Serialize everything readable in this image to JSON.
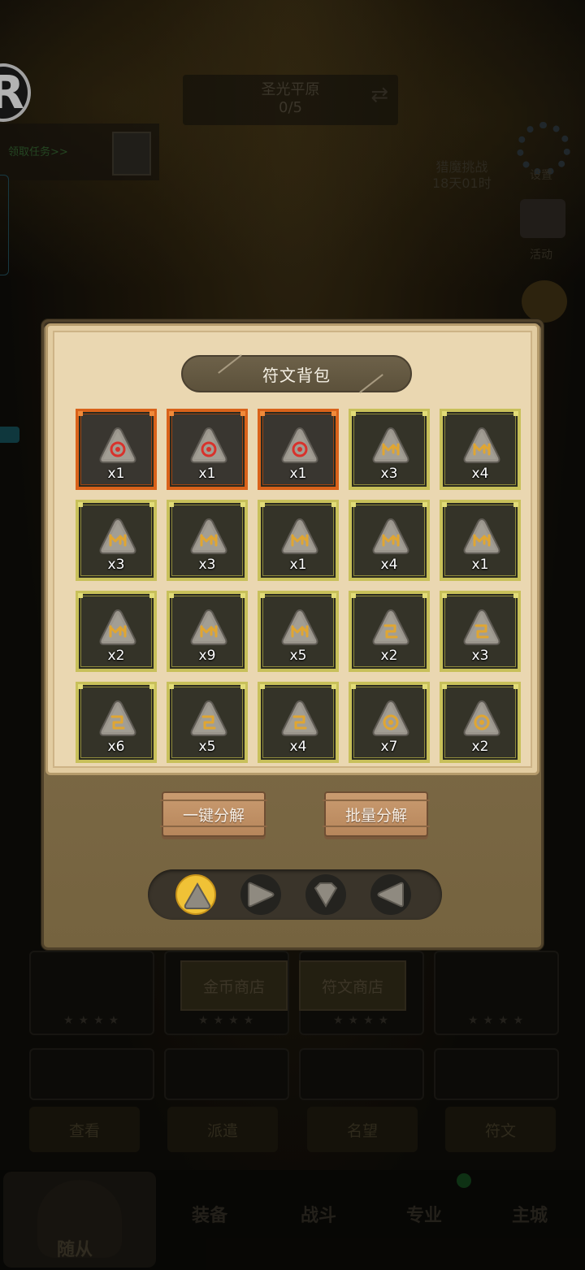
{
  "background": {
    "area_name": "圣光平原",
    "area_progress": "0/5",
    "task_link": "领取任务>>",
    "hunt_line1": "猎魔挑战",
    "hunt_line2": "18天01时",
    "settings_label": "设置",
    "notice_label": "活动",
    "gold_shop": "金币商店",
    "rune_shop": "符文商店",
    "tabs": [
      "查看",
      "派遣",
      "名望",
      "符文"
    ],
    "nav": [
      "随从",
      "装备",
      "战斗",
      "专业",
      "主城"
    ]
  },
  "panel": {
    "title": "符文背包",
    "decompose_all": "一键分解",
    "batch_decompose": "批量分解"
  },
  "runes": [
    {
      "quantity": "x1",
      "rarity": "orange",
      "glyph": "red-ring"
    },
    {
      "quantity": "x1",
      "rarity": "orange",
      "glyph": "red-ring"
    },
    {
      "quantity": "x1",
      "rarity": "orange",
      "glyph": "red-ring"
    },
    {
      "quantity": "x3",
      "rarity": "gold",
      "glyph": "m-rune"
    },
    {
      "quantity": "x4",
      "rarity": "gold",
      "glyph": "m-rune"
    },
    {
      "quantity": "x3",
      "rarity": "gold",
      "glyph": "m-rune"
    },
    {
      "quantity": "x3",
      "rarity": "gold",
      "glyph": "m-rune"
    },
    {
      "quantity": "x1",
      "rarity": "gold",
      "glyph": "m-rune"
    },
    {
      "quantity": "x4",
      "rarity": "gold",
      "glyph": "m-rune"
    },
    {
      "quantity": "x1",
      "rarity": "gold",
      "glyph": "m-rune"
    },
    {
      "quantity": "x2",
      "rarity": "gold",
      "glyph": "m-rune"
    },
    {
      "quantity": "x9",
      "rarity": "gold",
      "glyph": "m-rune"
    },
    {
      "quantity": "x5",
      "rarity": "gold",
      "glyph": "m-rune"
    },
    {
      "quantity": "x2",
      "rarity": "gold",
      "glyph": "square-rune"
    },
    {
      "quantity": "x3",
      "rarity": "gold",
      "glyph": "square-rune"
    },
    {
      "quantity": "x6",
      "rarity": "gold",
      "glyph": "square-rune"
    },
    {
      "quantity": "x5",
      "rarity": "gold",
      "glyph": "square-rune"
    },
    {
      "quantity": "x4",
      "rarity": "gold",
      "glyph": "square-rune"
    },
    {
      "quantity": "x7",
      "rarity": "gold",
      "glyph": "ring-rune"
    },
    {
      "quantity": "x2",
      "rarity": "gold",
      "glyph": "ring-rune"
    }
  ],
  "rune_types": [
    {
      "shape": "triangle-up",
      "active": true
    },
    {
      "shape": "triangle-right",
      "active": false
    },
    {
      "shape": "diamond-down",
      "active": false
    },
    {
      "shape": "triangle-left",
      "active": false
    }
  ],
  "colors": {
    "orange_frame": "#d9621a",
    "gold_frame": "#c8c05a",
    "parchment": "#ead7b1",
    "active_type": "#f0c236"
  }
}
